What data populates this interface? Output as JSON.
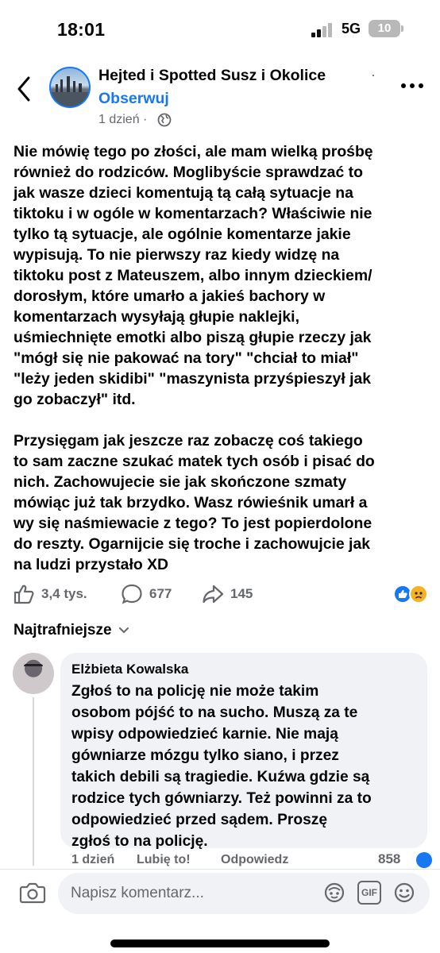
{
  "status_bar": {
    "time": "18:01",
    "network": "5G",
    "battery": "10"
  },
  "header": {
    "group_name": "Hejted i Spotted Susz i Okolice",
    "separator": "·",
    "follow_label": "Obserwuj",
    "time_ago": "1 dzień",
    "separator_2": "·",
    "icons": {
      "back": "chevron-left-icon",
      "privacy": "globe-icon",
      "more": "more-dots-icon"
    }
  },
  "post": {
    "text": "Nie mówię tego po złości, ale mam wielką prośbę\nrównież do rodziców. Moglibyście sprawdzać to\njak wasze dzieci komentują tą całą sytuacje na\ntiktoku i w ogóle w komentarzach? Właściwie nie\ntylko tą sytuacje, ale ogólnie komentarze jakie\nwypisują. To nie pierwszy raz kiedy widzę na\ntiktoku post z Mateuszem, albo innym dzieckiem/\ndorosłym, które umarło a jakieś bachory w\nkomentarzach wysyłają głupie naklejki,\nuśmiechnięte emotki albo piszą głupie rzeczy jak\n\"mógł się nie pakować na tory\" \"chciał to miał\"\n\"leży jeden skidibi\" \"maszynista przyśpieszył jak\ngo zobaczył\" itd.\n\nPrzysięgam jak jeszcze raz zobaczę coś takiego\nto sam zaczne szukać matek tych osób i pisać do\nnich. Zachowujecie sie jak skończone szmaty\nmówiąc już tak brzydko. Wasz rówieśnik umarł a\nwy się naśmiewacie z tego? To jest popierdolone\ndo reszty. Ogarnijcie się troche i zachowujcie jak\nna ludzi przystało XD"
  },
  "actions": {
    "likes": "3,4 tys.",
    "comments": "677",
    "shares": "145",
    "icons": {
      "like": "thumbs-up-icon",
      "comment": "comment-bubble-icon",
      "share": "share-arrow-icon"
    },
    "reactions": [
      "like-reaction-icon",
      "sad-reaction-icon"
    ],
    "colors": {
      "like": "#1877f2",
      "sad": "#f7b125"
    }
  },
  "sort": {
    "label": "Najtrafniejsze",
    "icon": "chevron-down-icon"
  },
  "comment": {
    "author": "Elżbieta Kowalska",
    "text": "Zgłoś to na policję nie może takim\nosobom pójść to na sucho. Muszą za te\nwpisy odpowiedzieć karnie. Nie mają\ngówniarze mózgu tylko siano, i przez\ntakich debili są tragiedie. Kuźwa gdzie są\nrodzice tych gówniarzy. Też powinni za to\nodpowiedzieć przed sądem. Proszę\nzgłoś to na policję.",
    "time": "1 dzień",
    "like_label": "Lubię to!",
    "reply_label": "Odpowiedz",
    "reaction_count": "858"
  },
  "composer": {
    "placeholder": "Napisz komentarz...",
    "icons": [
      "camera-icon",
      "avatar-sticker-icon",
      "gif-icon",
      "emoji-icon"
    ],
    "gif_label": "GIF"
  },
  "colors": {
    "accent": "#1877f2",
    "secondary_text": "#65676b",
    "bubble": "#f0f2f5"
  }
}
